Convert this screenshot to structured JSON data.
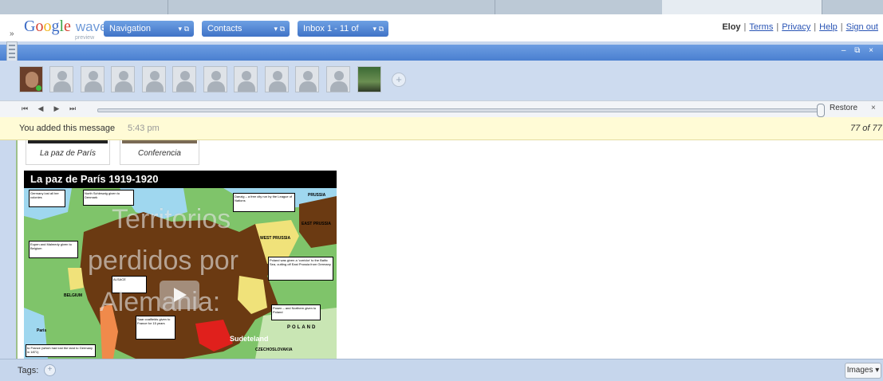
{
  "header": {
    "logo_text": "Google",
    "logo_wave": "wave",
    "logo_sub": "preview",
    "nav_buttons": [
      {
        "label": "Navigation",
        "controls": "▾ ⧉"
      },
      {
        "label": "Contacts",
        "controls": "▾ ⧉"
      },
      {
        "label": "Inbox 1 - 11 of",
        "controls": "▾ ⧉"
      }
    ],
    "user": "Eloy",
    "links": [
      "Terms",
      "Privacy",
      "Help",
      "Sign out"
    ],
    "expand": "»"
  },
  "window_controls": "‒ ⧉ ×",
  "participants": {
    "count_generic": 10,
    "add": "+"
  },
  "playback": {
    "first": "⏮",
    "prev": "◀",
    "next": "▶",
    "last": "⏭",
    "restore_label": "Restore",
    "close": "×",
    "position": 1.0
  },
  "notice": {
    "message": "You added this message",
    "time": "5:43 pm",
    "count": "77 of 77"
  },
  "thumbnails": [
    {
      "caption": "La paz de París"
    },
    {
      "caption": "Conferencia"
    }
  ],
  "video": {
    "title": "La paz de París 1919-1920",
    "overlay_lines": [
      "Territorios",
      "perdidos por",
      "Alemania:"
    ],
    "map_labels": [
      "Germany lost all her colonies",
      "North Schleswig given to Denmark",
      "Danzig – a free city run by the League of Nations",
      "PRUSSIA",
      "EAST PRUSSIA",
      "WEST PRUSSIA",
      "Eupen and Malmedy given to Belgium",
      "Poland was given a 'corridor' to the Baltic Sea, cutting off East Prussia from Germany",
      "BELGIUM",
      "Posen – and Northern given to Poland",
      "Paris",
      "Saar coalfields given to France for 15 years",
      "Sudeteland",
      "POLAND",
      "CZECHOSLOVAKIA",
      "ALSACE",
      "to France (which had lost the land to Germany in 1871)"
    ]
  },
  "footer": {
    "tags_label": "Tags:",
    "tags_add": "+",
    "images_label": "Images ▾"
  },
  "colors": {
    "accent_blue": "#4a7fd0",
    "notice_yellow": "#fffbd6",
    "germany_brown": "#6b3a12",
    "lost_territory_yellow": "#f0e27a",
    "alsace_orange": "#f08a4b",
    "highlight_red": "#e0201c"
  }
}
